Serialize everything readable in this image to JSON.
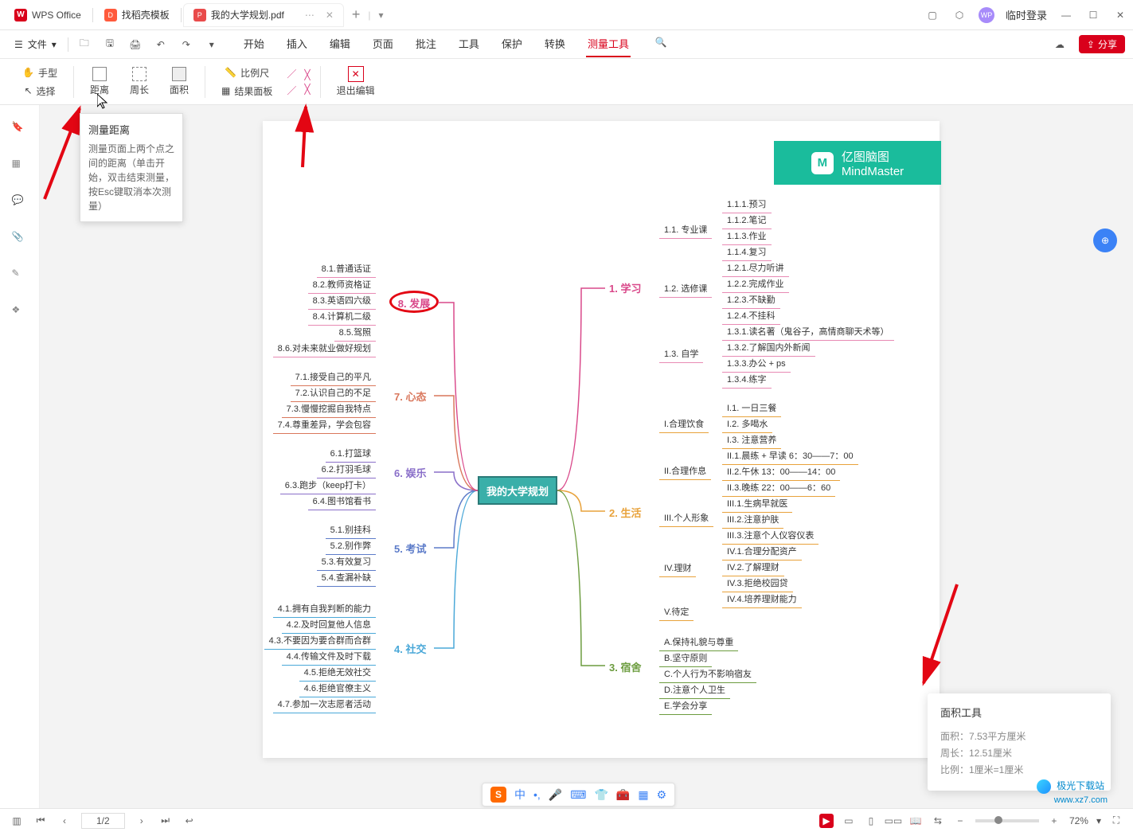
{
  "titlebar": {
    "tab_wps": "WPS Office",
    "tab_template": "找稻壳模板",
    "tab_pdf": "我的大学规划.pdf",
    "login": "临时登录"
  },
  "menubar": {
    "file": "文件",
    "tabs": [
      "开始",
      "插入",
      "编辑",
      "页面",
      "批注",
      "工具",
      "保护",
      "转换",
      "测量工具"
    ],
    "share": "分享"
  },
  "ribbon": {
    "hand": "手型",
    "select": "选择",
    "distance": "距离",
    "perimeter": "周长",
    "area": "面积",
    "ruler": "比例尺",
    "result_panel": "结果面板",
    "exit_edit": "退出编辑"
  },
  "tooltip": {
    "title": "测量距离",
    "body": "测量页面上两个点之间的距离（单击开始，双击结束测量，按Esc键取消本次测量）"
  },
  "mindmap": {
    "brand_cn": "亿图脑图",
    "brand_en": "MindMaster",
    "center": "我的大学规划",
    "p1": "1. 学习",
    "p2": "2. 生活",
    "p3": "3. 宿舍",
    "p4": "4. 社交",
    "p5": "5. 考试",
    "p6": "6. 娱乐",
    "p7": "7. 心态",
    "p8": "8. 发展",
    "study_sec": [
      "1.1. 专业课",
      "1.2. 选修课",
      "1.3. 自学"
    ],
    "study_11": [
      "1.1.1.预习",
      "1.1.2.笔记",
      "1.1.3.作业",
      "1.1.4.复习"
    ],
    "study_12": [
      "1.2.1.尽力听讲",
      "1.2.2.完成作业",
      "1.2.3.不缺勤",
      "1.2.4.不挂科"
    ],
    "study_13": [
      "1.3.1.读名著（鬼谷子，高情商聊天术等）",
      "1.3.2.了解国内外新闻",
      "1.3.3.办公 + ps",
      "1.3.4.练字"
    ],
    "life_sec": [
      "I.合理饮食",
      "II.合理作息",
      "III.个人形象",
      "IV.理财",
      "V.待定"
    ],
    "life_1": [
      "I.1. 一日三餐",
      "I.2. 多喝水",
      "I.3. 注意营养"
    ],
    "life_2": [
      "II.1.晨练 + 早读 6：30——7：00",
      "II.2.午休 13：00——14：00",
      "II.3.晚练 22：00——6：60"
    ],
    "life_3": [
      "III.1.生病早就医",
      "III.2.注意护肤",
      "III.3.注意个人仪容仪表"
    ],
    "life_4": [
      "IV.1.合理分配资产",
      "IV.2.了解理财",
      "IV.3.拒绝校园贷",
      "IV.4.培养理财能力"
    ],
    "dorm": [
      "A.保持礼貌与尊重",
      "B.坚守原则",
      "C.个人行为不影响宿友",
      "D.注意个人卫生",
      "E.学会分享"
    ],
    "social": [
      "4.1.拥有自我判断的能力",
      "4.2.及时回复他人信息",
      "4.3.不要因为要合群而合群",
      "4.4.传输文件及时下载",
      "4.5.拒绝无效社交",
      "4.6.拒绝官僚主义",
      "4.7.参加一次志愿者活动"
    ],
    "exam": [
      "5.1.别挂科",
      "5.2.别作弊",
      "5.3.有效复习",
      "5.4.查漏补缺"
    ],
    "ent": [
      "6.1.打篮球",
      "6.2.打羽毛球",
      "6.3.跑步（keep打卡）",
      "6.4.图书馆看书"
    ],
    "mind": [
      "7.1.接受自己的平凡",
      "7.2.认识自己的不足",
      "7.3.慢慢挖掘自我特点",
      "7.4.尊重差异，学会包容"
    ],
    "dev": [
      "8.1.普通话证",
      "8.2.教师资格证",
      "8.3.英语四六级",
      "8.4.计算机二级",
      "8.5.驾照",
      "8.6.对未来就业做好规划"
    ]
  },
  "area_popup": {
    "title": "面积工具",
    "area": "面积：7.53平方厘米",
    "peri": "周长：12.51厘米",
    "ratio": "比例：1厘米=1厘米"
  },
  "statusbar": {
    "page": "1/2",
    "zoom": "72%"
  },
  "ime": {
    "lang": "中"
  },
  "watermark": "极光下载站",
  "watermark_url": "www.xz7.com"
}
